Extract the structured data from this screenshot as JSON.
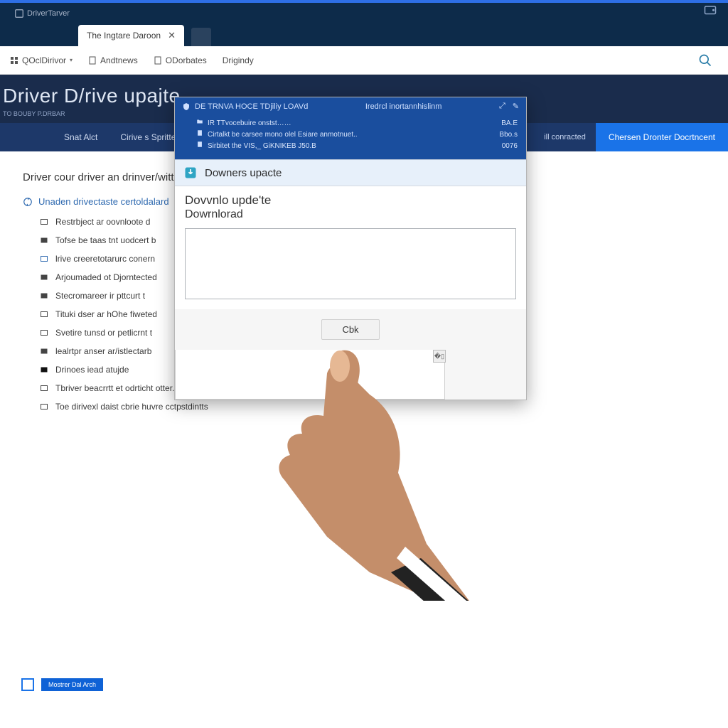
{
  "titlebar": {
    "app_name": "DriverTarver"
  },
  "tabs": {
    "active_label": "The Ingtare Daroon",
    "close_glyph": "✕"
  },
  "toolbar": {
    "item1": "QOclDirivor",
    "item2": "Andtnews",
    "item3": "ODorbates",
    "item4": "Drigindy",
    "caret": "▾"
  },
  "hero": {
    "title": "Driver D/rive upajte",
    "sub": "TO BOUBY P.DRBAR"
  },
  "navbar": {
    "n1": "Snat Alct",
    "n2": "Cirive s Spritter",
    "status": "ill conracted",
    "cta": "Chersen Dronter Docrtncent"
  },
  "content": {
    "heading": "Driver cour driver an drinver/witth",
    "lead": "Unaden drivectaste certoldalard",
    "items": [
      "Restrbject ar oovnloote d",
      "Tofse be taas tnt uodcert b",
      "lrive creeretotarurc conern",
      "Arjoumaded ot Djorntected",
      "Stecromareer ir pttcurt t",
      "Tituki dser ar hOhe fiweted",
      "Svetire tunsd or petlicrnt t",
      "lealrtpr anser ar/istlectarb",
      "Drinoes iead atujde",
      "Tbriver beacrrtt et odrticht otter.",
      "Toe dirivexl daist cbrie huvre cctpstdintts"
    ]
  },
  "footer": {
    "chip_label": "Mostrer Dal Arch"
  },
  "dialog": {
    "hdr_left": "DE TRNVA HOCE TDjiliy LOAVd",
    "hdr_right": "Iredrcl inortannhislinm",
    "info_rows": [
      {
        "l": "IR TTvocebuire onstst……",
        "r": "BA.E"
      },
      {
        "l": "Cirtalkt be carsee mono olel Esiare anmotnuet..",
        "r": "Bbo.s"
      },
      {
        "l": "Sirbitet the VIS,_ GiKNIKEB J50.B",
        "r": "0076"
      }
    ],
    "body_hdr": "Downers upacte",
    "body_l1": "Dovvnlo upde'te",
    "body_l2": "Dowrnlorad",
    "ok": "Cbk",
    "ctrl_min": "⤢",
    "ctrl_close": "✎"
  }
}
